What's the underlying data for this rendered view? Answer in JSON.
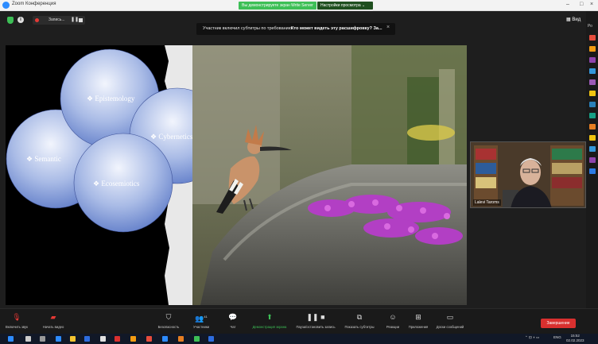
{
  "window": {
    "title": "Zoom Конференция"
  },
  "share_banner": "Вы демонстрируете экран Write Server",
  "view_options": "Настройки просмотра ⌄",
  "recording": {
    "label": "Запись..."
  },
  "caption_bar": {
    "message": "Участник включил субтитры по требованию",
    "who_can_see": "Кто может видеть эту расшифровку? За..."
  },
  "view_button": "Вид",
  "slide": {
    "circles": [
      {
        "label": "Epistemology"
      },
      {
        "label": "Semantic"
      },
      {
        "label": "Cybernetics"
      },
      {
        "label": "Ecosemiotics"
      }
    ]
  },
  "participant": {
    "name": "Lalevi Taroms"
  },
  "controls": {
    "unmute": "Включить звук",
    "start_video": "Начать видео",
    "security": "Безопасность",
    "participants": "Участники",
    "participants_count": "41",
    "chat": "Чат",
    "share_screen": "Демонстрация экрана",
    "pause_recording": "Пауза/остановить запись",
    "show_captions": "Показать субтитры",
    "reactions": "Реакции",
    "apps": "Приложения",
    "whiteboards": "Доски сообщений",
    "leave": "Завершение"
  },
  "taskbar": {
    "tray_text": "ENG",
    "time": "15:52",
    "date": "02.02.2023"
  },
  "colors": {
    "share_green": "#3dbf56",
    "leave_red": "#d9302f",
    "circle_blue": "#7d96d6"
  }
}
